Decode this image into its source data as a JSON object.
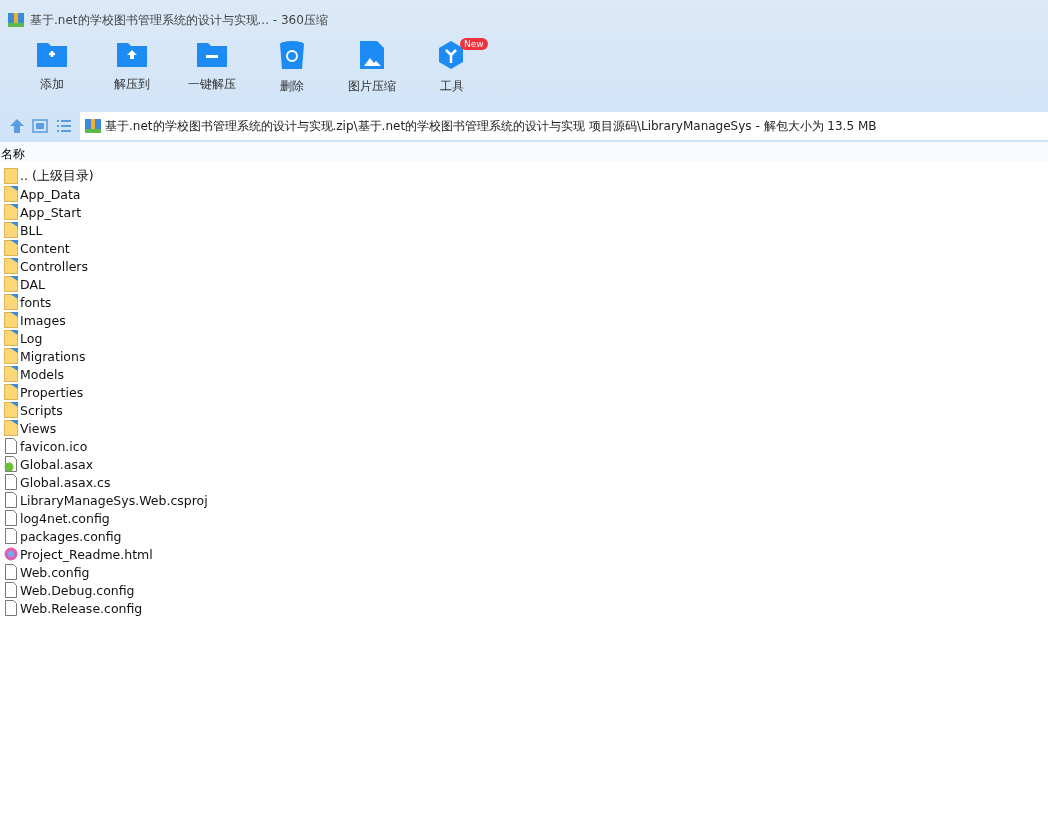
{
  "window": {
    "title": "基于.net的学校图书管理系统的设计与实现... - 360压缩"
  },
  "toolbar": [
    {
      "label": "添加",
      "kind": "add"
    },
    {
      "label": "解压到",
      "kind": "extract"
    },
    {
      "label": "一键解压",
      "kind": "oneclick"
    },
    {
      "label": "删除",
      "kind": "delete"
    },
    {
      "label": "图片压缩",
      "kind": "image"
    },
    {
      "label": "工具",
      "kind": "tools",
      "badge": "New"
    }
  ],
  "address": {
    "path": "基于.net的学校图书管理系统的设计与实现.zip\\基于.net的学校图书管理系统的设计与实现 项目源码\\LibraryManageSys - 解包大小为 13.5 MB"
  },
  "table": {
    "columns": [
      "名称"
    ],
    "rows": [
      {
        "name": ".. (上级目录)",
        "kind": "up"
      },
      {
        "name": "App_Data",
        "kind": "folder"
      },
      {
        "name": "App_Start",
        "kind": "folder"
      },
      {
        "name": "BLL",
        "kind": "folder"
      },
      {
        "name": "Content",
        "kind": "folder"
      },
      {
        "name": "Controllers",
        "kind": "folder"
      },
      {
        "name": "DAL",
        "kind": "folder"
      },
      {
        "name": "fonts",
        "kind": "folder"
      },
      {
        "name": "Images",
        "kind": "folder"
      },
      {
        "name": "Log",
        "kind": "folder"
      },
      {
        "name": "Migrations",
        "kind": "folder"
      },
      {
        "name": "Models",
        "kind": "folder"
      },
      {
        "name": "Properties",
        "kind": "folder"
      },
      {
        "name": "Scripts",
        "kind": "folder"
      },
      {
        "name": "Views",
        "kind": "folder"
      },
      {
        "name": "favicon.ico",
        "kind": "file"
      },
      {
        "name": "Global.asax",
        "kind": "asax"
      },
      {
        "name": "Global.asax.cs",
        "kind": "file"
      },
      {
        "name": "LibraryManageSys.Web.csproj",
        "kind": "file"
      },
      {
        "name": "log4net.config",
        "kind": "file"
      },
      {
        "name": "packages.config",
        "kind": "file"
      },
      {
        "name": "Project_Readme.html",
        "kind": "html"
      },
      {
        "name": "Web.config",
        "kind": "file"
      },
      {
        "name": "Web.Debug.config",
        "kind": "file"
      },
      {
        "name": "Web.Release.config",
        "kind": "file"
      }
    ]
  }
}
